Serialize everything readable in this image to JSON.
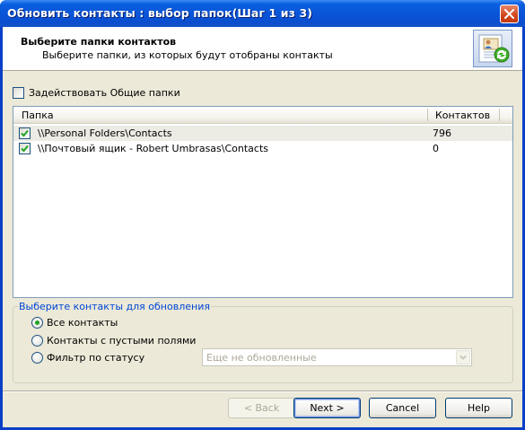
{
  "window": {
    "title": "Обновить контакты : выбор папок(Шаг 1 из 3)"
  },
  "header": {
    "title": "Выберите папки контактов",
    "subtitle": "Выберите папки, из которых будут отобраны контакты",
    "icon": "contacts-refresh-icon"
  },
  "public_folders": {
    "label": "Задействовать Общие папки",
    "checked": false
  },
  "folders": {
    "columns": [
      "Папка",
      "Контактов"
    ],
    "rows": [
      {
        "path": "\\\\Personal Folders\\Contacts",
        "count": "796",
        "checked": true,
        "selected": true
      },
      {
        "path": "\\\\Почтовый ящик - Robert Umbrasas\\Contacts",
        "count": "0",
        "checked": true,
        "selected": false
      }
    ]
  },
  "update_options": {
    "title": "Выберите контакты для обновления",
    "options": [
      {
        "label": "Все контакты",
        "selected": true
      },
      {
        "label": "Контакты с пустыми полями",
        "selected": false
      },
      {
        "label": "Фильтр по статусу",
        "selected": false
      }
    ],
    "status_filter_value": "Еще не обновленные"
  },
  "buttons": {
    "back": "< Back",
    "next": "Next >",
    "cancel": "Cancel",
    "help": "Help"
  },
  "colors": {
    "titlebar": "#0a55d8",
    "dialog_bg": "#ece9d8",
    "group_title": "#0046d5",
    "radio_dot": "#21a121",
    "check": "#21a121"
  }
}
